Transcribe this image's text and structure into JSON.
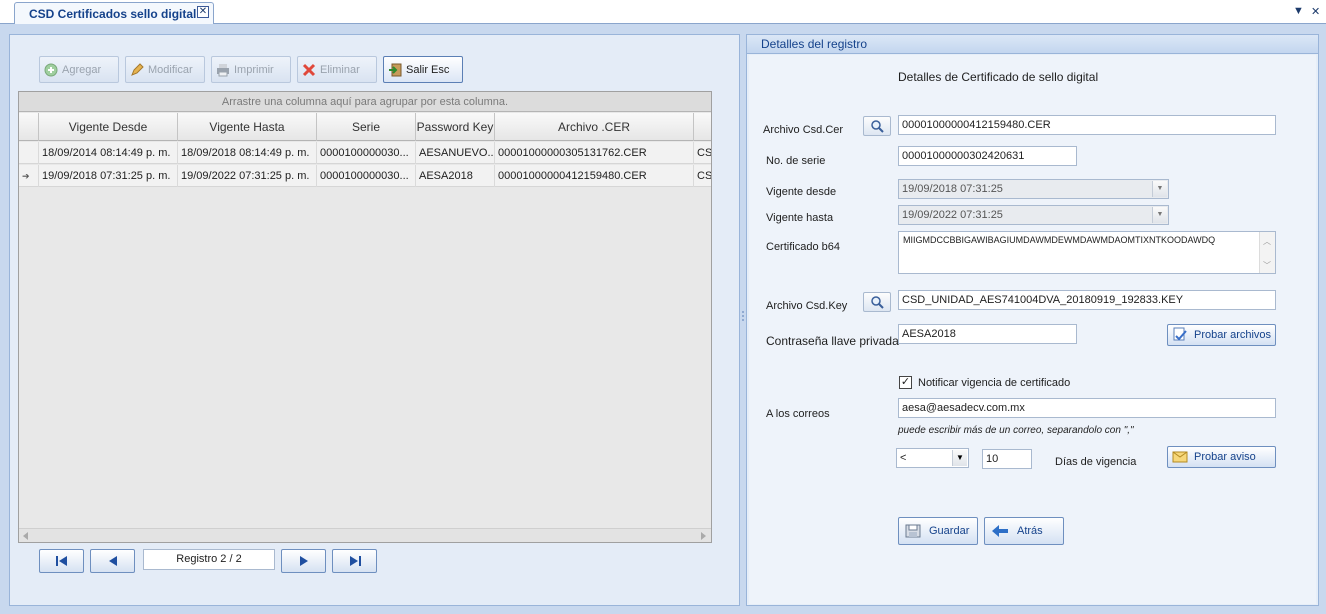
{
  "tab": {
    "title": "CSD Certificados sello digital",
    "close": "✕"
  },
  "window": {
    "dropdown": "▼",
    "close": "✕"
  },
  "toolbar": {
    "agregar": "Agregar",
    "modificar": "Modificar",
    "imprimir": "Imprimir",
    "eliminar": "Eliminar",
    "salir": "Salir  Esc"
  },
  "grid": {
    "group_hint": "Arrastre una columna aquí para agrupar por esta columna.",
    "columns": [
      "Vigente Desde",
      "Vigente Hasta",
      "Serie",
      "Password Key",
      "Archivo .CER"
    ],
    "rows": [
      [
        "18/09/2014 08:14:49 p. m.",
        "18/09/2018 08:14:49 p. m.",
        "0000100000030...",
        "AESANUEVO...",
        "00001000000305131762.CER",
        "CSI"
      ],
      [
        "19/09/2018 07:31:25 p. m.",
        "19/09/2022 07:31:25 p. m.",
        "0000100000030...",
        "AESA2018",
        "00001000000412159480.CER",
        "CSI"
      ]
    ],
    "current_row_marker": "➔"
  },
  "navigator": {
    "label": "Registro  2 / 2"
  },
  "details": {
    "header": "Detalles del registro",
    "title": "Detalles de Certificado de sello digital",
    "archivo_cer_label": "Archivo  Csd.Cer",
    "archivo_cer_value": "00001000000412159480.CER",
    "no_serie_label": "No. de serie",
    "no_serie_value": "00001000000302420631",
    "vigente_desde_label": "Vigente desde",
    "vigente_desde_value": "19/09/2018 07:31:25",
    "vigente_hasta_label": "Vigente hasta",
    "vigente_hasta_value": "19/09/2022 07:31:25",
    "certificado_label": "Certificado b64",
    "certificado_value": "MIIGMDCCBBIGAWIBAGIUMDAWMDEWMDAWMDAOMTIXNTKOODAWDQ",
    "archivo_key_label": "Archivo Csd.Key",
    "archivo_key_value": "CSD_UNIDAD_AES741004DVA_20180919_192833.KEY",
    "password_label": "Contraseña llave privada",
    "password_value": "AESA2018",
    "probar_archivos": "Probar archivos",
    "notificar_label": "Notificar vigencia de certificado",
    "notificar_checked": "✓",
    "correos_label": "A los correos",
    "correos_value": "aesa@aesadecv.com.mx",
    "correos_hint": "puede escribir más de un correo, separandolo con \",\"",
    "operator_value": "<",
    "dias_value": "10",
    "dias_label": "Días de vigencia",
    "probar_aviso": "Probar aviso",
    "guardar": "Guardar",
    "atras": "Atrás"
  }
}
